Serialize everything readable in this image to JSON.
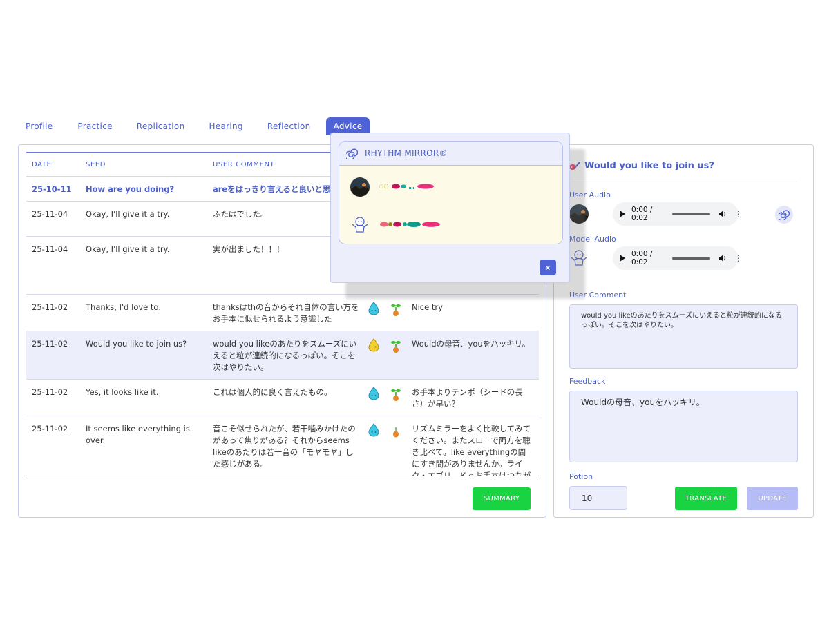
{
  "tabs": [
    {
      "label": "Profile"
    },
    {
      "label": "Practice"
    },
    {
      "label": "Replication"
    },
    {
      "label": "Hearing"
    },
    {
      "label": "Reflection"
    },
    {
      "label": "Advice"
    }
  ],
  "table": {
    "headers": {
      "date": "DATE",
      "seed": "SEED",
      "comment": "USER COMMENT"
    },
    "rows": [
      {
        "date": "25-10-11",
        "seed": "How are you doing?",
        "comment": "areをはっきり言えると良いと思",
        "feedback": ""
      },
      {
        "date": "25-11-04",
        "seed": "Okay, I'll give it a try.",
        "comment": "ふたばでした。",
        "feedback": ""
      },
      {
        "date": "25-11-04",
        "seed": "Okay, I'll give it a try.",
        "comment": "実が出ました！！！",
        "feedback": ""
      },
      {
        "date": "25-11-02",
        "seed": "Thanks, I'd love to.",
        "comment": "thanksはthの音からそれ自体の言い方をお手本に似せられるよう意識した",
        "feedback": "Nice try"
      },
      {
        "date": "25-11-02",
        "seed": "Would you like to join us?",
        "comment": "would you likeのあたりをスムーズにいえると粒が連続的になるっぽい。そこを次はやりたい。",
        "feedback": "Wouldの母音、youをハッキリ。"
      },
      {
        "date": "25-11-02",
        "seed": "Yes, it looks like it.",
        "comment": "これは個人的に良く言えたもの。",
        "feedback": "お手本よりテンポ（シードの長さ）が早い？"
      },
      {
        "date": "25-11-02",
        "seed": "It seems like everything is over.",
        "comment": "音こそ似せられたが、若干噛みかけたのがあって焦りがある？それからseems likeのあたりは若干音の「モヤモヤ」した感じがある。",
        "feedback": "リズムミラーをよく比較してみてください。またスローで両方を聴き比べて。like everythingの間にすき間がありませんか。ライク・エブリ　Ｋｅお手本はつながっている。everyのｉ音"
      }
    ]
  },
  "buttons": {
    "summary": "SUMMARY",
    "translate": "TRANSLATE",
    "update": "UPDATE",
    "close": "×"
  },
  "detail": {
    "title": "Would you like to join us?",
    "user_audio_label": "User Audio",
    "model_audio_label": "Model Audio",
    "user_time": "0:00 / 0:02",
    "model_time": "0:00 / 0:02",
    "user_comment_label": "User Comment",
    "user_comment": "would you likeのあたりをスムーズにいえると粒が連続的になるっぽい。そこを次はやりたい。",
    "feedback_label": "Feedback",
    "feedback": "Wouldの母音、youをハッキリ。",
    "potion_label": "Potion",
    "potion": "10"
  },
  "popup": {
    "title": "RHYTHM MIRROR®"
  },
  "colors": {
    "accent": "#4f62d6",
    "green": "#1ad343",
    "panel_bg": "#eceefb",
    "card_bg": "#fdfae8",
    "update_disabled": "#b6bcf5"
  }
}
